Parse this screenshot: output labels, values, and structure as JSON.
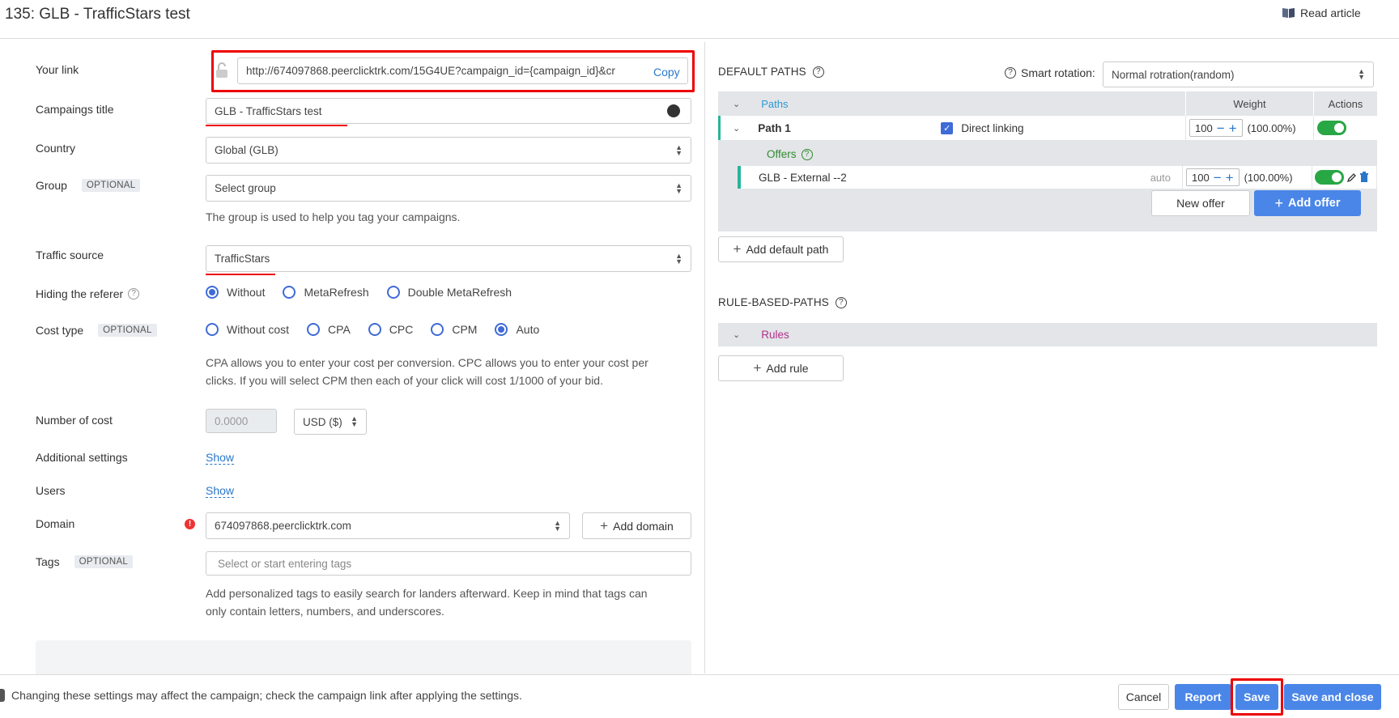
{
  "header": {
    "title": "135: GLB - TrafficStars test",
    "read_article": "Read article"
  },
  "form": {
    "your_link": {
      "label": "Your link",
      "value": "http://674097868.peerclicktrk.com/15G4UE?campaign_id={campaign_id}&cr",
      "copy_label": "Copy"
    },
    "campaign_title": {
      "label": "Campaings title",
      "value": "GLB - TrafficStars test"
    },
    "country": {
      "label": "Country",
      "value": "Global (GLB)"
    },
    "group": {
      "label": "Group",
      "badge": "OPTIONAL",
      "placeholder": "Select group",
      "help": "The group is used to help you tag your campaigns."
    },
    "traffic_source": {
      "label": "Traffic source",
      "value": "TrafficStars"
    },
    "hiding_referer": {
      "label": "Hiding the referer",
      "help_icon": "?",
      "options": [
        {
          "label": "Without",
          "checked": true
        },
        {
          "label": "MetaRefresh",
          "checked": false
        },
        {
          "label": "Double MetaRefresh",
          "checked": false
        }
      ]
    },
    "cost_type": {
      "label": "Cost type",
      "badge": "OPTIONAL",
      "options": [
        {
          "label": "Without cost",
          "checked": false
        },
        {
          "label": "CPA",
          "checked": false
        },
        {
          "label": "CPC",
          "checked": false
        },
        {
          "label": "CPM",
          "checked": false
        },
        {
          "label": "Auto",
          "checked": true
        }
      ],
      "help_line1": "CPA allows you to enter your cost per conversion. CPC allows you to enter your cost per",
      "help_line2": "clicks. If you will select CPM then each of your click will cost 1/1000 of your bid."
    },
    "number_of_cost": {
      "label": "Number of cost",
      "placeholder": "0.0000",
      "currency": "USD ($)"
    },
    "additional_settings": {
      "label": "Additional settings",
      "link": "Show"
    },
    "users": {
      "label": "Users",
      "link": "Show"
    },
    "domain": {
      "label": "Domain",
      "alert": "!",
      "value": "674097868.peerclicktrk.com",
      "add_label": "Add domain"
    },
    "tags": {
      "label": "Tags",
      "badge": "OPTIONAL",
      "placeholder": "Select or start entering tags",
      "help_line1": "Add personalized tags to easily search for landers afterward. Keep in mind that tags can",
      "help_line2": "only contain letters, numbers, and underscores."
    }
  },
  "right": {
    "default_paths": {
      "title": "DEFAULT PATHS",
      "smart_rotation_label": "Smart rotation:",
      "smart_rotation_value": "Normal rotration(random)",
      "col_paths": "Paths",
      "col_weight": "Weight",
      "col_actions": "Actions",
      "path": {
        "name": "Path 1",
        "direct_linking": "Direct linking",
        "weight": "100",
        "percent": "(100.00%)",
        "enabled": true
      },
      "offers_label": "Offers",
      "offer": {
        "name": "GLB - External --2",
        "mode": "auto",
        "weight": "100",
        "percent": "(100.00%)",
        "enabled": true
      },
      "new_offer": "New offer",
      "add_offer": "Add offer",
      "add_default_path": "Add default path"
    },
    "rule_based": {
      "title": "RULE-BASED-PATHS",
      "rules_label": "Rules",
      "add_rule": "Add rule"
    }
  },
  "footer": {
    "note": "Changing these settings may affect the campaign; check the campaign link after applying the settings.",
    "cancel": "Cancel",
    "report": "Report",
    "save": "Save",
    "save_close": "Save and close"
  },
  "colors": {
    "accent": "#4a86e8",
    "link": "#2a77c9",
    "highlight": "#e00000",
    "toggle_on": "#28a745",
    "path_marker": "#26b59a"
  }
}
